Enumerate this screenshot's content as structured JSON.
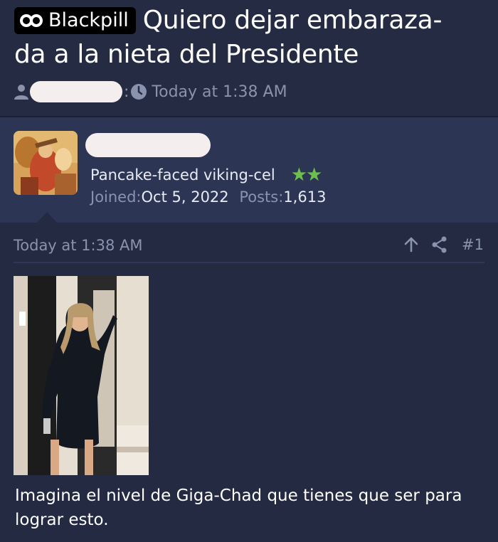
{
  "thread": {
    "prefix": "Blackpill",
    "title_line1": "Quiero dejar embaraza-",
    "title_line2": "da a la nieta del Presidente",
    "meta_separator": ":",
    "meta_time": "Today at 1:38 AM"
  },
  "author": {
    "title": "Pancake-faced viking-cel",
    "stars": "★★",
    "joined_label": "Joined:",
    "joined_value": "Oct 5, 2022",
    "posts_label": "Posts:",
    "posts_value": "1,613"
  },
  "post": {
    "date": "Today at 1:38 AM",
    "number": "#1",
    "body": "Imagina el nivel de Giga-Chad que tienes que ser para lograr esto."
  },
  "icons": {
    "prefix": "infinity-icon",
    "user": "user-icon",
    "clock": "clock-icon",
    "upvote": "arrow-up-icon",
    "share": "share-icon"
  },
  "colors": {
    "background": "#232a42",
    "user_block": "#2c3654",
    "muted": "#8a93ad",
    "stars": "#6ec04c"
  }
}
